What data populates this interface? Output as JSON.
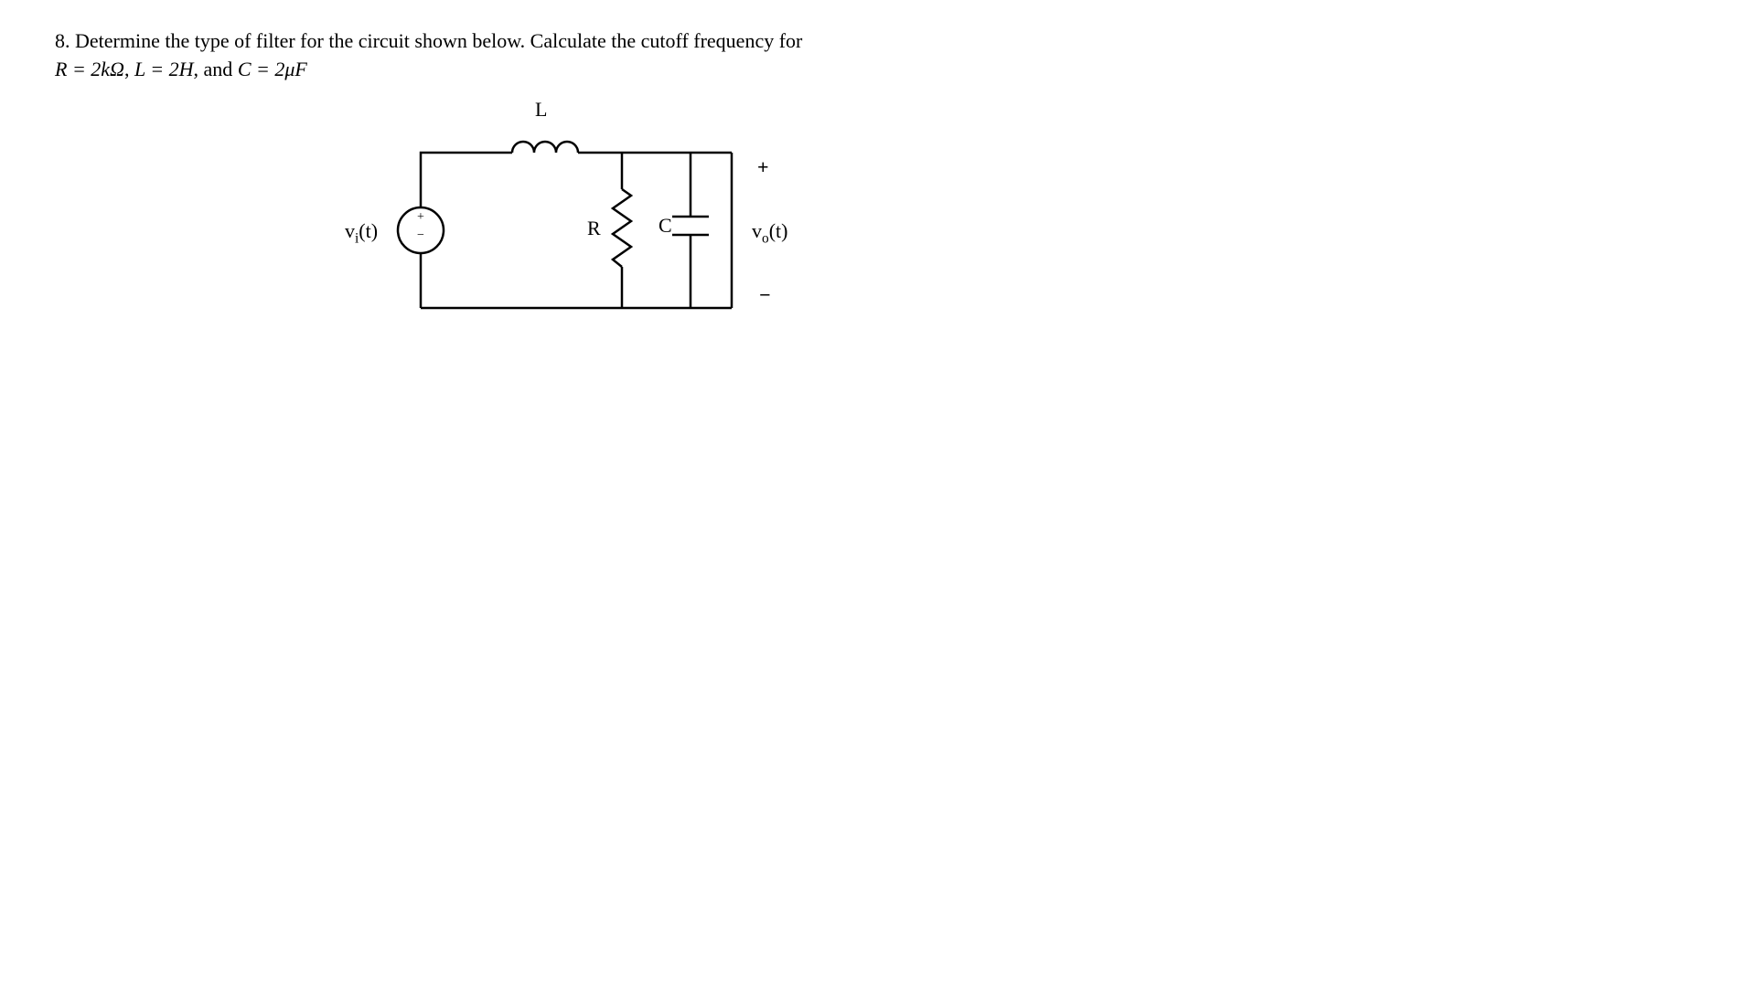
{
  "problem": {
    "number": "8.",
    "text_part1": "Determine the type of filter for the circuit shown below. Calculate the cutoff frequency for",
    "line2_prefix": "",
    "R_eq": "R = 2kΩ",
    "comma1": ", ",
    "L_eq": "L = 2H",
    "comma2": ", and ",
    "C_eq": "C = 2μF"
  },
  "circuit": {
    "L_label": "L",
    "R_label": "R",
    "C_label": "C",
    "vi_label": "v",
    "vi_sub": "i",
    "vi_paren": "(t)",
    "vo_label": "v",
    "vo_sub": "o",
    "vo_paren": "(t)",
    "plus_top": "+",
    "minus_bottom": "−",
    "plus_src": "+",
    "minus_src": "−"
  }
}
